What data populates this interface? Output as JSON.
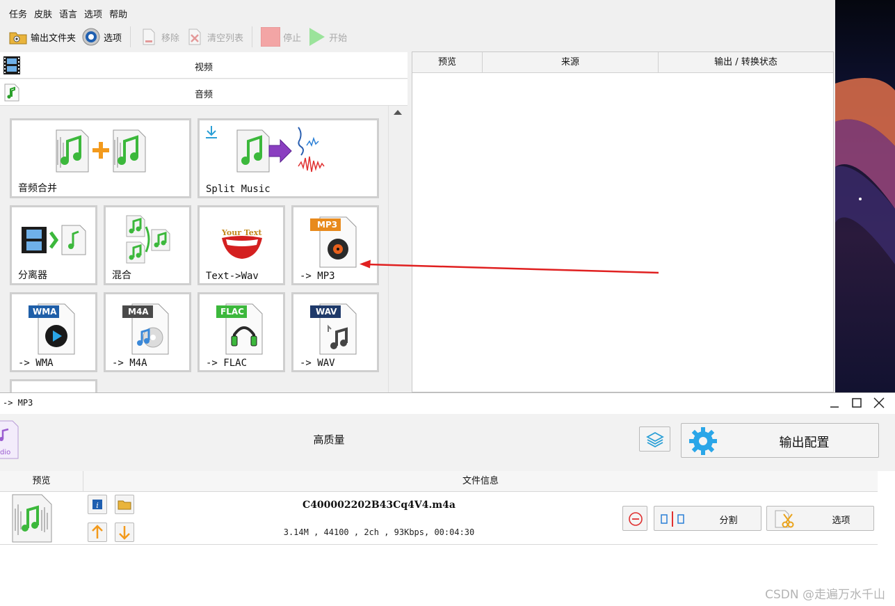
{
  "menu": [
    "任务",
    "皮肤",
    "语言",
    "选项",
    "帮助"
  ],
  "toolbar": {
    "output_folder": "输出文件夹",
    "options": "选项",
    "remove": "移除",
    "clear_list": "清空列表",
    "stop": "停止",
    "start": "开始"
  },
  "categories": {
    "video": "视频",
    "audio": "音频"
  },
  "tools": {
    "audio_merge": "音频合并",
    "split_music": "Split Music",
    "separator": "分离器",
    "mix": "混合",
    "text_to_wav": "Text->Wav",
    "to_mp3": "-> MP3",
    "to_wma": "-> WMA",
    "to_m4a": "-> M4A",
    "to_flac": "-> FLAC",
    "to_wav": "-> WAV"
  },
  "tile_badges": {
    "mp3": "MP3",
    "wma": "WMA",
    "m4a": "M4A",
    "flac": "FLAC",
    "wav": "WAV",
    "your_text": "Your Text"
  },
  "list_columns": [
    "预览",
    "来源",
    "输出 / 转换状态"
  ],
  "dialog": {
    "title": "-> MP3",
    "quality": "高质量",
    "output_config": "输出配置",
    "columns": [
      "预览",
      "文件信息"
    ],
    "file": {
      "name": "C400002202B43Cq4V4.m4a",
      "meta": "3.14M , 44100 , 2ch , 93Kbps, 00:04:30",
      "split": "分割",
      "options": "选项"
    },
    "partial_icon_text": "dio"
  },
  "watermark": "CSDN @走遍万水千山",
  "colors": {
    "arrow": "#e02020",
    "accent_blue": "#2a9fd6",
    "music_green": "#3cb83c",
    "toolbar_disabled": "#a8a8a8"
  }
}
